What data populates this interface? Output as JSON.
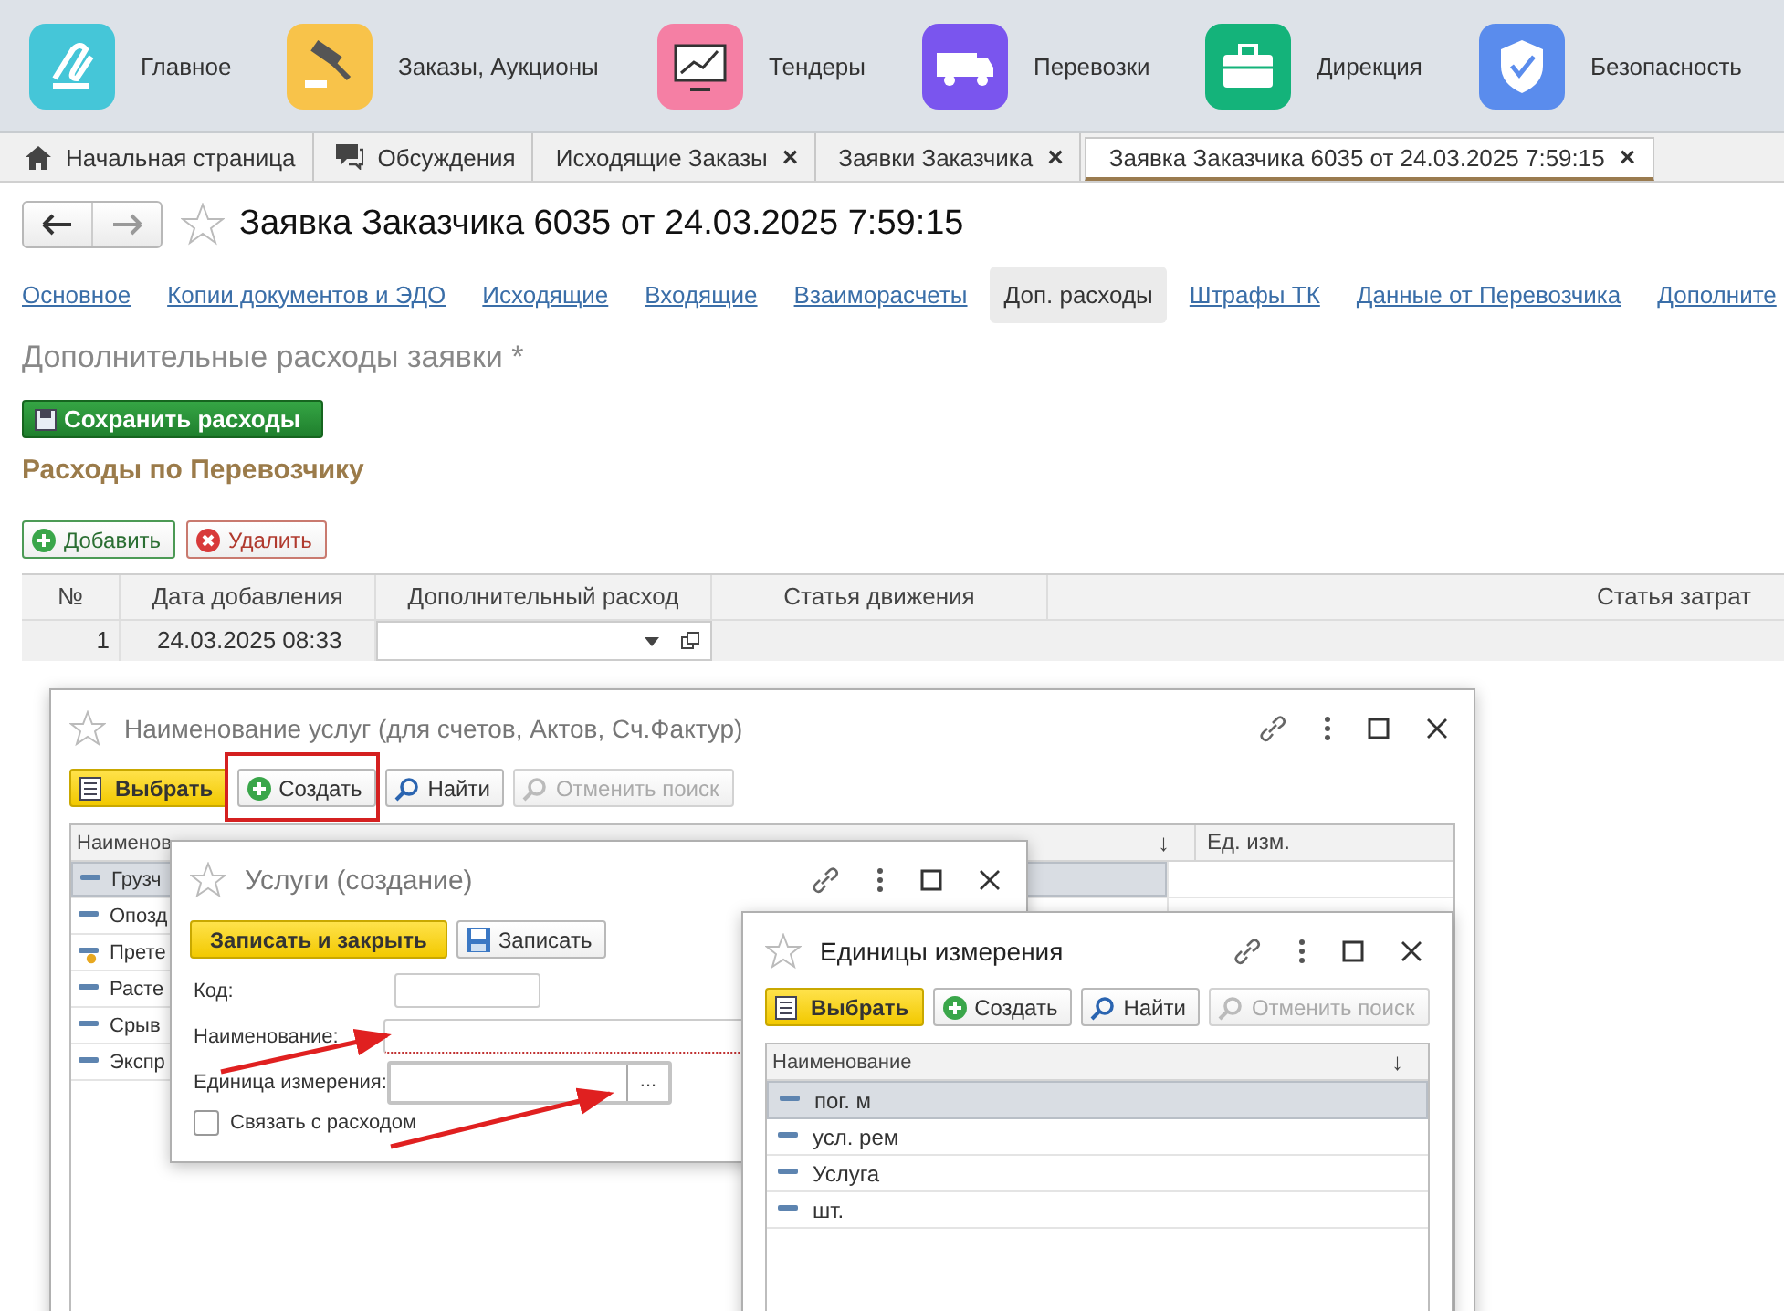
{
  "sections": [
    {
      "label": "Главное",
      "kind": "main",
      "color": "#45c6d8"
    },
    {
      "label": "Заказы, Аукционы",
      "kind": "auction",
      "color": "#f8c34a"
    },
    {
      "label": "Тендеры",
      "kind": "tenders",
      "color": "#f57fa4"
    },
    {
      "label": "Перевозки",
      "kind": "transport",
      "color": "#7a55ee"
    },
    {
      "label": "Дирекция",
      "kind": "management",
      "color": "#14b37a"
    },
    {
      "label": "Безопасность",
      "kind": "security",
      "color": "#5a8ced"
    }
  ],
  "tabs": [
    {
      "label": "Начальная страница",
      "kind": "home",
      "selected": false,
      "closable": false
    },
    {
      "label": "Обсуждения",
      "kind": "chat",
      "selected": false,
      "closable": false
    },
    {
      "label": "Исходящие Заказы",
      "kind": "plain",
      "selected": false,
      "closable": true
    },
    {
      "label": "Заявки Заказчика",
      "kind": "plain",
      "selected": false,
      "closable": true
    },
    {
      "label": "Заявка Заказчика 6035 от 24.03.2025 7:59:15",
      "kind": "plain",
      "selected": true,
      "closable": true
    }
  ],
  "close_glyph": "×",
  "document": {
    "title": "Заявка Заказчика 6035 от 24.03.2025 7:59:15",
    "nav_tabs": [
      {
        "label": "Основное",
        "selected": false
      },
      {
        "label": "Копии документов и ЭДО",
        "selected": false
      },
      {
        "label": "Исходящие",
        "selected": false
      },
      {
        "label": "Входящие",
        "selected": false
      },
      {
        "label": "Взаиморасчеты",
        "selected": false
      },
      {
        "label": "Доп. расходы",
        "selected": true
      },
      {
        "label": "Штрафы ТК",
        "selected": false
      },
      {
        "label": "Данные от Перевозчика",
        "selected": false
      },
      {
        "label": "Дополните",
        "selected": false
      }
    ],
    "heading": "Дополнительные расходы заявки *",
    "save_button": "Сохранить расходы",
    "section_title": "Расходы по Перевозчику",
    "add_button": "Добавить",
    "delete_button": "Удалить",
    "table": {
      "columns": [
        "№",
        "Дата добавления",
        "Дополнительный расход",
        "Статья движения",
        "Статья затрат"
      ],
      "rows": [
        [
          "1",
          "24.03.2025 08:33"
        ]
      ]
    }
  },
  "services_dialog": {
    "title": "Наименование услуг (для счетов, Актов, Сч.Фактур)",
    "select_button": "Выбрать",
    "create_button": "Создать",
    "find_button": "Найти",
    "cancel_search_button": "Отменить поиск",
    "cancel_disabled": true,
    "columns": [
      "Наименов",
      "↓",
      "Ед. изм."
    ],
    "rows": [
      {
        "name": "Грузч",
        "kind": "item",
        "selected": true
      },
      {
        "name": "Опозд",
        "kind": "item",
        "selected": false
      },
      {
        "name": "Прете",
        "kind": "marked",
        "selected": false
      },
      {
        "name": "Расте",
        "kind": "item",
        "selected": false
      },
      {
        "name": "Срыв",
        "kind": "item",
        "selected": false
      },
      {
        "name": "Экспр",
        "kind": "item",
        "selected": false
      }
    ]
  },
  "create_dialog": {
    "title": "Услуги (создание)",
    "save_close_button": "Записать и закрыть",
    "save_button": "Записать",
    "code_label": "Код:",
    "name_label": "Наименование:",
    "name_required": true,
    "unit_label": "Единица измерения:",
    "unit_button": "...",
    "link_checkbox": {
      "label": "Связать с расходом",
      "checked": false
    }
  },
  "units_dialog": {
    "title": "Единицы измерения",
    "select_button": "Выбрать",
    "create_button": "Создать",
    "find_button": "Найти",
    "cancel_search_button": "Отменить поиск",
    "cancel_disabled": true,
    "columns": [
      "Наименование",
      "↓"
    ],
    "rows": [
      {
        "name": "пог. м",
        "selected": true
      },
      {
        "name": "усл. рем",
        "selected": false
      },
      {
        "name": "Услуга",
        "selected": false
      },
      {
        "name": "шт.",
        "selected": false
      }
    ]
  }
}
